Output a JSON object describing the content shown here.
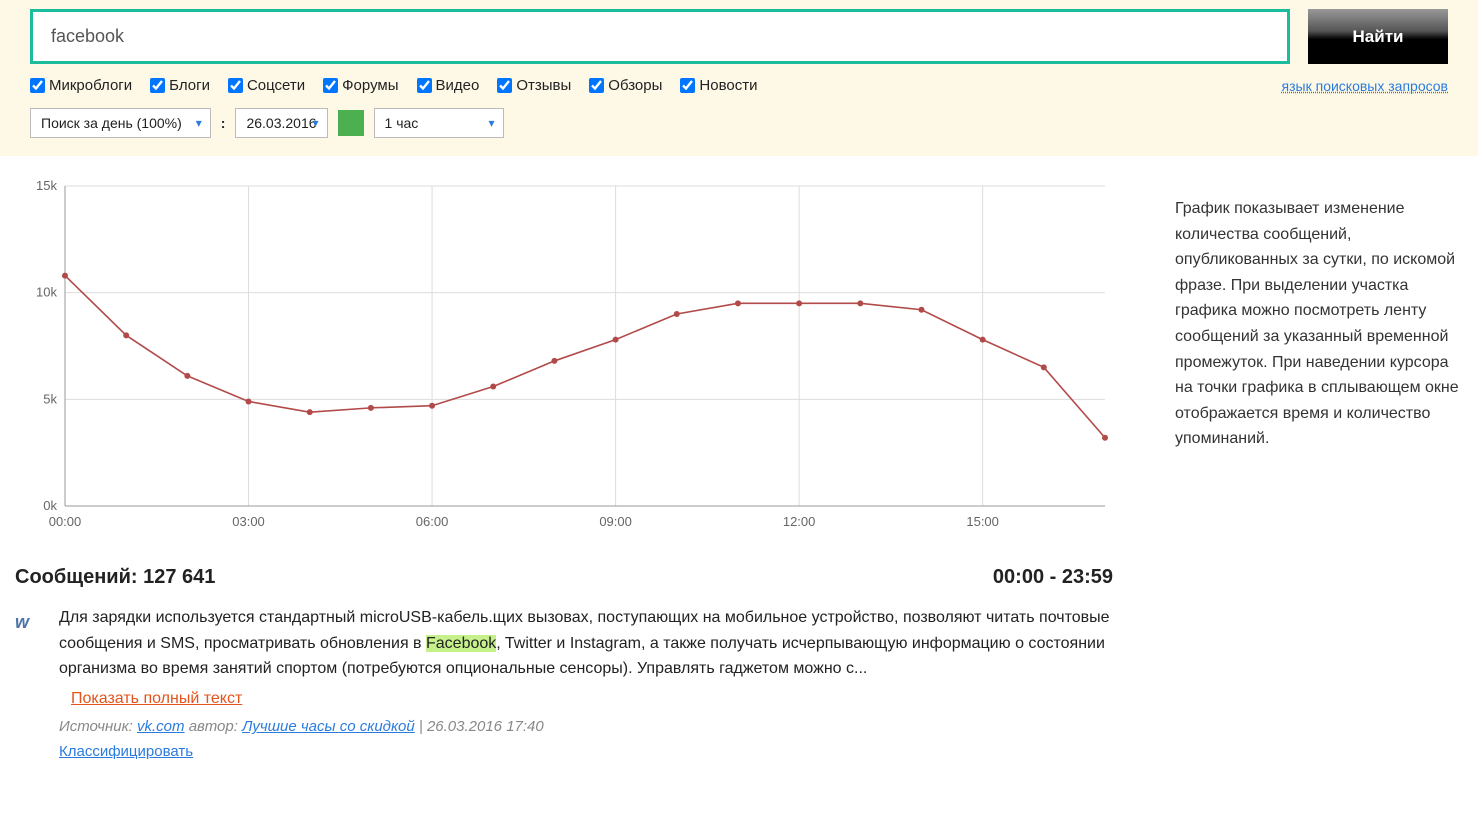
{
  "search": {
    "query": "facebook",
    "button": "Найти"
  },
  "filters": {
    "items": [
      "Микроблоги",
      "Блоги",
      "Соцсети",
      "Форумы",
      "Видео",
      "Отзывы",
      "Обзоры",
      "Новости"
    ],
    "query_lang": "язык поисковых запросов"
  },
  "date_row": {
    "period": "Поиск за день (100%)",
    "date": "26.03.2016",
    "interval": "1 час"
  },
  "chart_desc": "График показывает изменение количества сообщений, опубликованных за сутки, по искомой фразе. При выделении участка графика можно посмотреть ленту сообщений за указанный временной промежуток. При наведении курсора на точки графика в сплывающем окне отображается время и количество упоминаний.",
  "chart_data": {
    "type": "line",
    "xlabel": "",
    "ylabel": "",
    "ylim": [
      0,
      15000
    ],
    "yticks": [
      {
        "label": "0k",
        "value": 0
      },
      {
        "label": "5k",
        "value": 5000
      },
      {
        "label": "10k",
        "value": 10000
      },
      {
        "label": "15k",
        "value": 15000
      }
    ],
    "xticks": [
      "00:00",
      "03:00",
      "06:00",
      "09:00",
      "12:00",
      "15:00"
    ],
    "categories": [
      "00:00",
      "01:00",
      "02:00",
      "03:00",
      "04:00",
      "05:00",
      "06:00",
      "07:00",
      "08:00",
      "09:00",
      "10:00",
      "11:00",
      "12:00",
      "13:00",
      "14:00",
      "15:00",
      "16:00",
      "17:00"
    ],
    "values": [
      10800,
      8000,
      6100,
      4900,
      4400,
      4600,
      4700,
      5600,
      6800,
      7800,
      9000,
      9500,
      9500,
      9500,
      9200,
      7800,
      6500,
      3200
    ]
  },
  "results": {
    "count_label": "Сообщений:",
    "count_value": "127 641",
    "time_range": "00:00 - 23:59"
  },
  "item": {
    "text_a": "Для зарядки используется стандартный microUSB-кабель.щих вызовах, поступающих на мобильное устройство, позволяют читать почтовые сообщения и SMS, просматривать обновления в ",
    "hl": "Facebook",
    "text_b": ", Twitter и Instagram, а также получать исчерпывающую информацию о состоянии организма во время занятий спортом (потребуются опциональные сенсоры). Управлять гаджетом можно с...",
    "show_full": "Показать полный текст",
    "src_label": "Источник:",
    "src_site": "vk.com",
    "author_label": "автор:",
    "author": "Лучшие часы со скидкой",
    "dt": "26.03.2016 17:40",
    "classify": "Классифицировать"
  }
}
